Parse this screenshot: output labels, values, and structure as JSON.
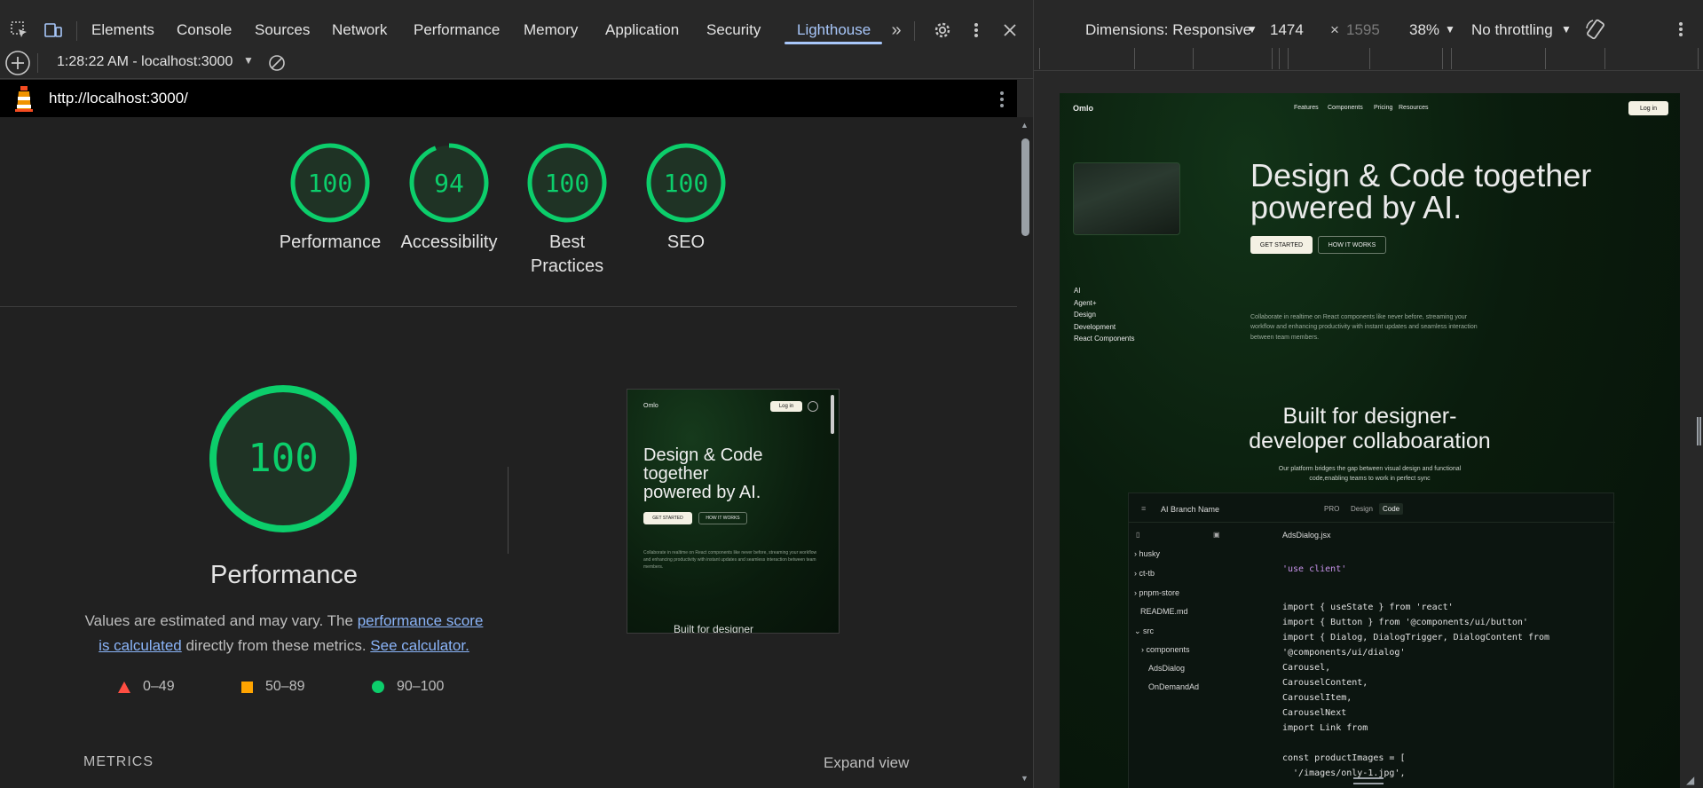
{
  "devtools": {
    "tabs": [
      "Elements",
      "Console",
      "Sources",
      "Network",
      "Performance",
      "Memory",
      "Application",
      "Security",
      "Lighthouse"
    ],
    "active_tab": "Lighthouse",
    "report_selector": "1:28:22 AM - localhost:3000",
    "url": "http://localhost:3000/"
  },
  "scores": [
    {
      "label": "Performance",
      "value": "100",
      "fraction": 1.0
    },
    {
      "label": "Accessibility",
      "value": "94",
      "fraction": 0.94
    },
    {
      "label": "Best Practices",
      "value": "100",
      "fraction": 1.0
    },
    {
      "label": "SEO",
      "value": "100",
      "fraction": 1.0
    }
  ],
  "performance_section": {
    "score": "100",
    "title": "Performance",
    "desc_1": "Values are estimated and may vary. The ",
    "desc_link_1": "performance score is calculated",
    "desc_2": " directly from these metrics. ",
    "desc_link_2": "See calculator.",
    "legend": [
      {
        "range": "0–49",
        "color": "#ff4e42"
      },
      {
        "range": "50–89",
        "color": "#ffa400"
      },
      {
        "range": "90–100",
        "color": "#0cce6b"
      }
    ],
    "metrics_label": "METRICS",
    "expand_label": "Expand view"
  },
  "thumbnail": {
    "brand": "Omlo",
    "login": "Log in",
    "headline": "Design & Code together powered by AI.",
    "cta_primary": "GET STARTED",
    "cta_secondary": "HOW IT WORKS",
    "body": "Collaborate in realtime on React components like never before, streaming your workflow and enhancing productivity with instant updates and seamless interaction between team members.",
    "section_peek": "Built for designer"
  },
  "device_toolbar": {
    "dimensions_label": "Dimensions: Responsive",
    "width": "1474",
    "times": "×",
    "height": "1595",
    "zoom": "38%",
    "throttling": "No throttling"
  },
  "site": {
    "brand": "Omlo",
    "nav": [
      "Features",
      "Components",
      "Pricing",
      "Resources"
    ],
    "login": "Log in",
    "headline_1": "Design & Code together",
    "headline_2": "powered by AI.",
    "cta_primary": "GET STARTED",
    "cta_secondary": "HOW IT WORKS",
    "side_menu": [
      "AI",
      "Agent+",
      "Design",
      "Development",
      "React Components"
    ],
    "body_1": "Collaborate in realtime on React components like never before, streaming your",
    "body_2": "workflow and enhancing productivity with instant updates and seamless interaction",
    "body_3": "between team members.",
    "section_title_1": "Built for designer-",
    "section_title_2": "developer collaboaration",
    "section_sub_1": "Our platform bridges the gap between visual design and functional",
    "section_sub_2": "code,enabling teams to work in perfect sync",
    "editor": {
      "branch": "AI Branch Name",
      "tabs": [
        "PRO",
        "Design",
        "Code"
      ],
      "file": "AdsDialog.jsx",
      "tree": [
        "husky",
        "ct-tb",
        "pnpm-store",
        "README.md",
        "src",
        "components",
        "AdsDialog",
        "OnDemandAd"
      ],
      "code": [
        "'use client'",
        "",
        "import { useState } from 'react'",
        "import { Button } from '@components/ui/button'",
        "import { Dialog, DialogTrigger, DialogContent from",
        "'@components/ui/dialog'",
        "Carousel,",
        "CarouselContent,",
        "CarouselItem,",
        "CarouselNext",
        "import Link from",
        "",
        "const productImages = [",
        "  '/images/only-1.jpg',"
      ]
    }
  }
}
